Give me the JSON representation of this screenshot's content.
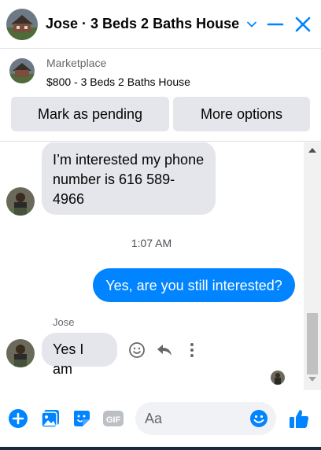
{
  "header": {
    "title": "Jose · 3 Beds 2 Baths House",
    "icons": [
      "house-photo",
      "chevron-down-icon",
      "minimize-icon",
      "close-icon"
    ]
  },
  "marketplace": {
    "label": "Marketplace",
    "listing": "$800 - 3 Beds 2 Baths House",
    "pending_button": "Mark as pending",
    "options_button": "More options"
  },
  "messages": {
    "incoming_1": "I’m interested my phone number is 616 589-4966",
    "timestamp": "1:07 AM",
    "outgoing_1": "Yes, are you still interested?",
    "sender_name": "Jose",
    "incoming_2": "Yes I am"
  },
  "composer": {
    "placeholder": "Aa",
    "icons": [
      "add-icon",
      "photo-icon",
      "sticker-icon",
      "gif-icon",
      "emoji-icon",
      "thumbs-up-icon"
    ]
  },
  "colors": {
    "accent": "#0084ff",
    "bubble_in": "#e4e6eb",
    "text": "#050505",
    "secondary_text": "#65676b"
  }
}
